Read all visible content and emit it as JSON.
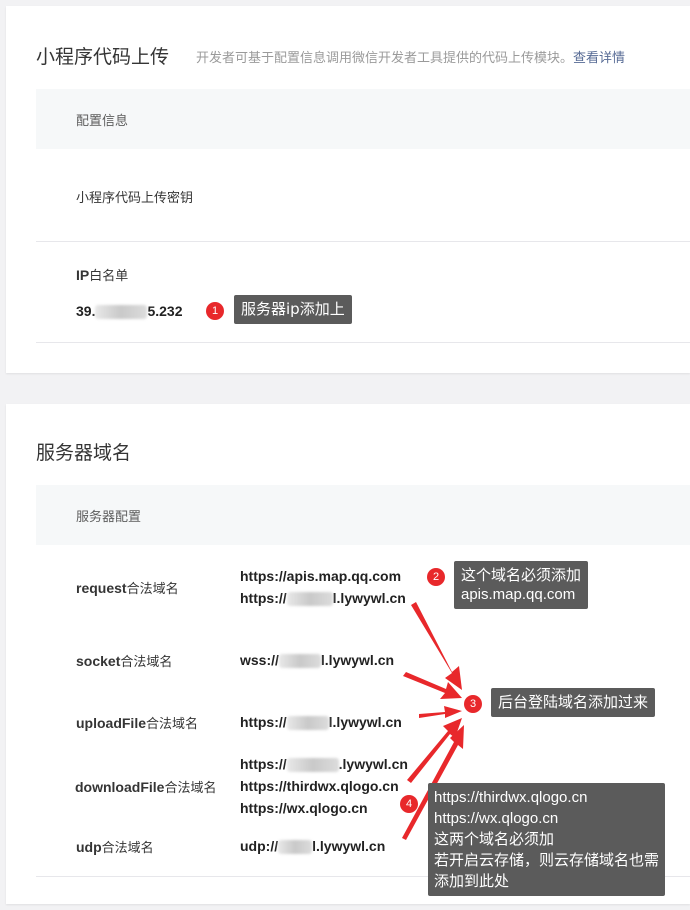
{
  "section1": {
    "title": "小程序代码上传",
    "desc": "开发者可基于配置信息调用微信开发者工具提供的代码上传模块。",
    "detail_link": "查看详情",
    "config_header": "配置信息",
    "secret_label": "小程序代码上传密钥",
    "ip_label_bold": "IP",
    "ip_label_rest": "白名单",
    "ip_prefix": "39.",
    "ip_suffix": "5.232"
  },
  "section2": {
    "title": "服务器域名",
    "config_header": "服务器配置",
    "rows": [
      {
        "bold": "request",
        "rest": "合法域名"
      },
      {
        "bold": "socket",
        "rest": "合法域名"
      },
      {
        "bold": "uploadFile",
        "rest": "合法域名"
      },
      {
        "bold": "downloadFile",
        "rest": "合法域名"
      },
      {
        "bold": "udp",
        "rest": "合法域名"
      }
    ],
    "request_1": "https://apis.map.qq.com",
    "request_2_prefix": "https://",
    "request_2_suffix": "l.lywywl.cn",
    "socket_prefix": "wss://",
    "socket_suffix": "l.lywywl.cn",
    "upload_prefix": "https://",
    "upload_suffix": "l.lywywl.cn",
    "download_1_prefix": "https://",
    "download_1_suffix": ".lywywl.cn",
    "download_2": "https://thirdwx.qlogo.cn",
    "download_3": "https://wx.qlogo.cn",
    "udp_prefix": "udp://",
    "udp_suffix": "l.lywywl.cn"
  },
  "annotations": {
    "b1": "1",
    "b2": "2",
    "b3": "3",
    "b4": "4",
    "tip1": "服务器ip添加上",
    "tip2_line1": "这个域名必须添加",
    "tip2_line2": "apis.map.qq.com",
    "tip3": "后台登陆域名添加过来",
    "tip4_lines": [
      "https://thirdwx.qlogo.cn",
      "https://wx.qlogo.cn",
      "这两个域名必须加",
      "若开启云存储，则云存储域名也需",
      "添加到此处"
    ]
  },
  "colors": {
    "badge": "#e8282b",
    "tooltip": "#5b5b5b",
    "arrow": "#e8282b",
    "link": "#576b95"
  }
}
